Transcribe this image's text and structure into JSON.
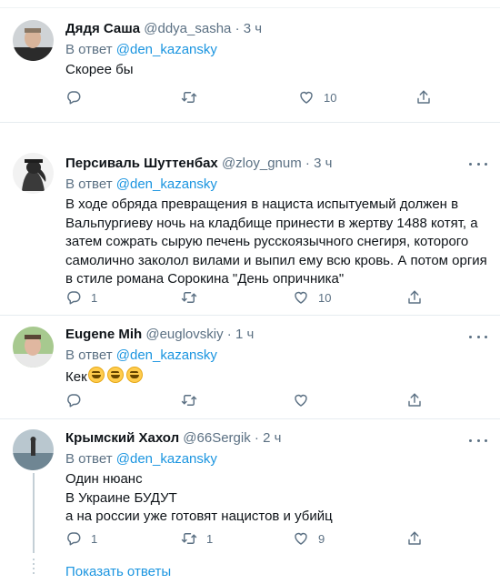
{
  "tweets": [
    {
      "name": "Дядя Саша",
      "handle": "@ddya_sasha",
      "time": "3 ч",
      "reply_prefix": "В ответ",
      "reply_to": "@den_kazansky",
      "text": "Скорее бы",
      "counts": {
        "reply": "",
        "retweet": "",
        "like": "10"
      }
    },
    {
      "name": "Персиваль Шуттенбах",
      "handle": "@zloy_gnum",
      "time": "3 ч",
      "reply_prefix": "В ответ",
      "reply_to": "@den_kazansky",
      "text": "В ходе обряда превращения в нациста испытуемый должен в Вальпургиеву ночь на кладбище принести в жертву 1488 котят, а затем сожрать сырую печень русскоязычного снегиря, которого самолично заколол вилами и выпил ему всю кровь. А потом оргия в стиле романа Сорокина \"День опричника\"",
      "counts": {
        "reply": "1",
        "retweet": "",
        "like": "10"
      }
    },
    {
      "name": "Eugene Mih",
      "handle": "@euglovskiy",
      "time": "1 ч",
      "reply_prefix": "В ответ",
      "reply_to": "@den_kazansky",
      "text": "Кек",
      "counts": {
        "reply": "",
        "retweet": "",
        "like": ""
      }
    },
    {
      "name": "Крымский Хахол",
      "handle": "@66Sergik",
      "time": "2 ч",
      "reply_prefix": "В ответ",
      "reply_to": "@den_kazansky",
      "text_lines": [
        "Один нюанс",
        "В Украине БУДУТ",
        "а на россии уже готовят нацистов и убийц"
      ],
      "counts": {
        "reply": "1",
        "retweet": "1",
        "like": "9"
      }
    }
  ],
  "show_replies": "Показать ответы",
  "icons": {
    "reply": "reply-icon",
    "retweet": "retweet-icon",
    "like": "like-icon",
    "share": "share-icon",
    "more": "more-options-icon",
    "emoji": "grinning-face-icon"
  },
  "colors": {
    "link": "#1b95e0",
    "muted": "#5b7083",
    "text": "#0f1419"
  }
}
